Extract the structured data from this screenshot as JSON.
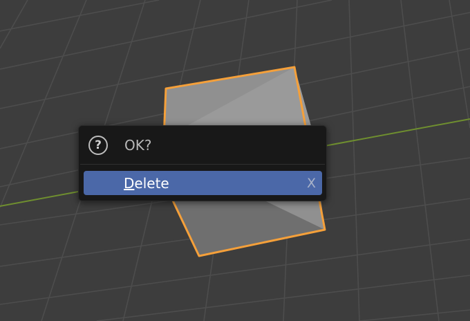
{
  "viewport": {
    "background": "#3d3d3d",
    "grid_color": "#4d4d4d",
    "x_axis_color": "#6f8f2f",
    "cube_face_color": "#8f8f8f",
    "cube_outline_color": "#f5a03a"
  },
  "popup": {
    "icon": "question-circle-icon",
    "title": "OK?",
    "menu_item": {
      "label_mnemonic": "D",
      "label_rest": "elete",
      "shortcut": "X",
      "highlight_color": "#4b68a8"
    }
  }
}
